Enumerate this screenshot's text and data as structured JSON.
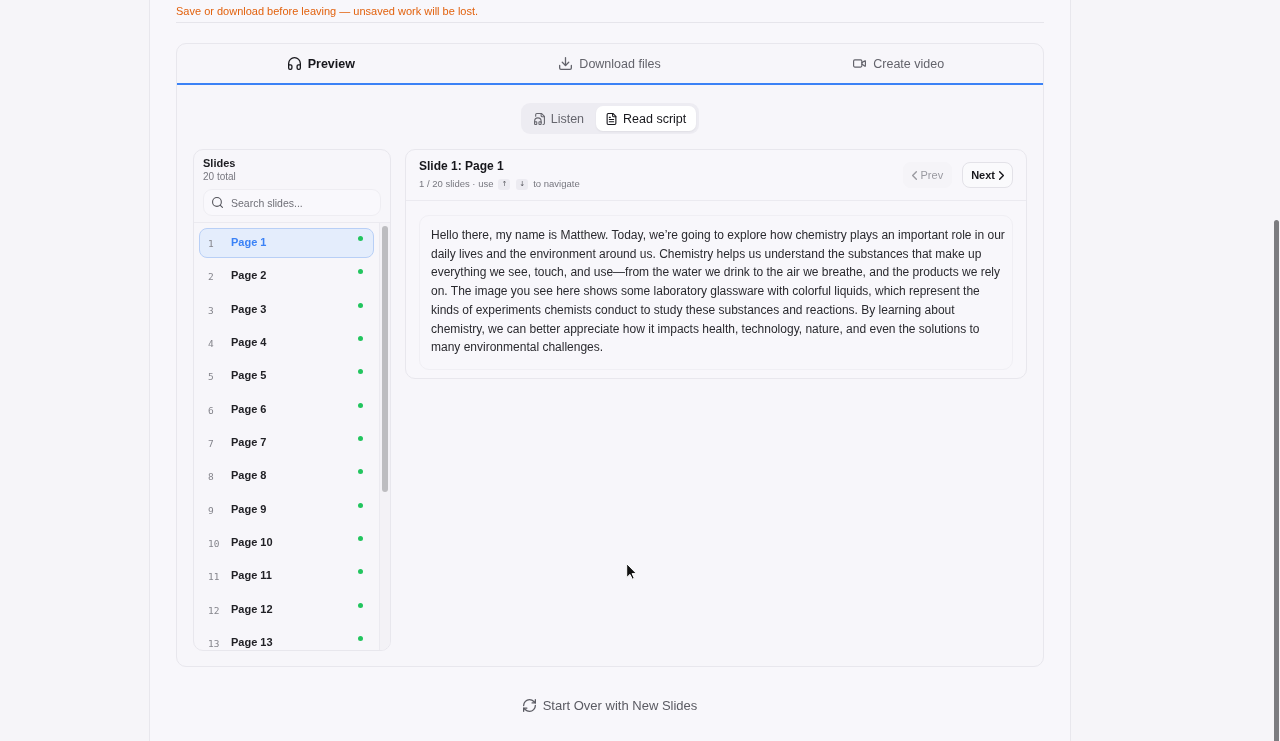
{
  "notice": "Save or download before leaving — unsaved work will be lost.",
  "tabs": [
    {
      "label": "Preview",
      "selected": true
    },
    {
      "label": "Download files",
      "selected": false
    },
    {
      "label": "Create video",
      "selected": false
    }
  ],
  "view_toggle": [
    {
      "label": "Listen",
      "selected": false
    },
    {
      "label": "Read script",
      "selected": true
    }
  ],
  "slides_panel": {
    "title": "Slides",
    "count": "20 total",
    "search": {
      "placeholder": "Search slides..."
    },
    "items": [
      {
        "number": "1",
        "label": "Page 1",
        "selected": true,
        "color": "#22c55e"
      },
      {
        "number": "2",
        "label": "Page 2",
        "selected": false,
        "color": "#22c55e"
      },
      {
        "number": "3",
        "label": "Page 3",
        "selected": false,
        "color": "#22c55e"
      },
      {
        "number": "4",
        "label": "Page 4",
        "selected": false,
        "color": "#22c55e"
      },
      {
        "number": "5",
        "label": "Page 5",
        "selected": false,
        "color": "#22c55e"
      },
      {
        "number": "6",
        "label": "Page 6",
        "selected": false,
        "color": "#22c55e"
      },
      {
        "number": "7",
        "label": "Page 7",
        "selected": false,
        "color": "#22c55e"
      },
      {
        "number": "8",
        "label": "Page 8",
        "selected": false,
        "color": "#22c55e"
      },
      {
        "number": "9",
        "label": "Page 9",
        "selected": false,
        "color": "#22c55e"
      },
      {
        "number": "10",
        "label": "Page 10",
        "selected": false,
        "color": "#22c55e"
      },
      {
        "number": "11",
        "label": "Page 11",
        "selected": false,
        "color": "#22c55e"
      },
      {
        "number": "12",
        "label": "Page 12",
        "selected": false,
        "color": "#22c55e"
      },
      {
        "number": "13",
        "label": "Page 13",
        "selected": false,
        "color": "#22c55e"
      }
    ]
  },
  "slide": {
    "title": "Slide 1: Page 1",
    "position": "1 / 20 slides · use",
    "keys": [
      "↑",
      "↓"
    ],
    "hint": "to navigate",
    "prev": {
      "label": "Prev",
      "disabled": true
    },
    "next": {
      "label": "Next",
      "disabled": false
    },
    "script": "Hello there, my name is Matthew. Today, we’re going to explore how chemistry plays an important role in our daily lives and the environment around us. Chemistry helps us understand the substances that make up everything we see, touch, and use—from the water we drink to the air we breathe, and the products we rely on. The image you see here shows some laboratory glassware with colorful liquids, which represent the kinds of experiments chemists conduct to study these substances and reactions. By learning about chemistry, we can better appreciate how it impacts health, technology, nature, and even the solutions to many environmental challenges."
  },
  "start_over": {
    "label": "Start Over with New Slides"
  }
}
